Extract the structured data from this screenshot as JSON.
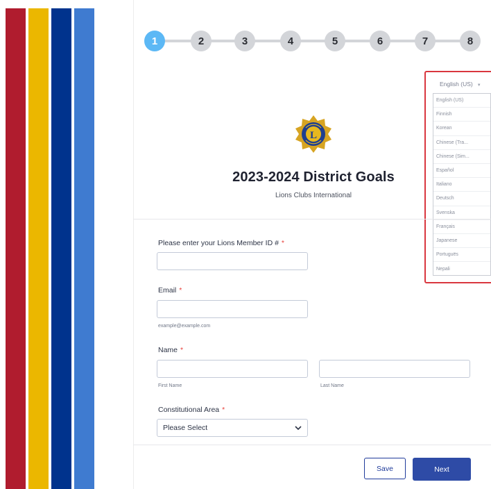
{
  "steps": [
    "1",
    "2",
    "3",
    "4",
    "5",
    "6",
    "7",
    "8"
  ],
  "active_step": 1,
  "header": {
    "title": "2023-2024 District Goals",
    "subtitle": "Lions Clubs International",
    "logo_text": "LIONS INTERNATIONAL"
  },
  "language": {
    "current": "English (US)",
    "options": [
      "English (US)",
      "Finnish",
      "Korean",
      "Chinese (Tra...",
      "Chinese (Sim...",
      "Español",
      "Italiano",
      "Deutsch",
      "Svenska",
      "Français",
      "Japanese",
      "Portuguës",
      "Nepali"
    ]
  },
  "form": {
    "member_id_label": "Please enter your Lions Member ID #",
    "email_label": "Email",
    "email_sublabel": "example@example.com",
    "name_label": "Name",
    "first_name_sublabel": "First Name",
    "last_name_sublabel": "Last Name",
    "area_label": "Constitutional Area",
    "area_selected": "Please Select",
    "required_mark": "*"
  },
  "buttons": {
    "save": "Save",
    "next": "Next"
  },
  "colors": {
    "stripe_red": "#b01c2e",
    "stripe_gold": "#ebb700",
    "stripe_navy": "#00338d",
    "stripe_blue": "#3f7bd0",
    "active_step": "#5cb8f5",
    "next_button": "#2e4ba6",
    "highlight": "#d9363e"
  }
}
